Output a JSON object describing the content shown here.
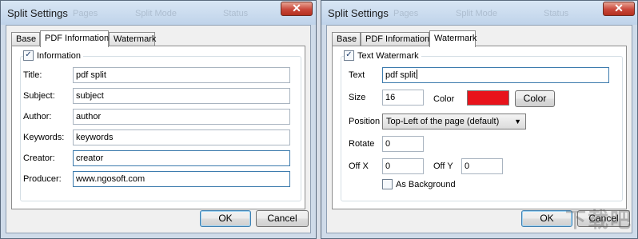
{
  "left": {
    "title": "Split Settings",
    "ghost_items": [
      "Pages",
      "Split Mode",
      "Status"
    ],
    "tabs": [
      "Base",
      "PDF Information",
      "Watermark"
    ],
    "information_label": "Information",
    "fields": [
      {
        "label": "Title:",
        "value": "pdf split"
      },
      {
        "label": "Subject:",
        "value": "subject"
      },
      {
        "label": "Author:",
        "value": "author"
      },
      {
        "label": "Keywords:",
        "value": "keywords"
      },
      {
        "label": "Creator:",
        "value": "creator"
      },
      {
        "label": "Producer:",
        "value": "www.ngosoft.com"
      }
    ],
    "ok_label": "OK",
    "cancel_label": "Cancel"
  },
  "right": {
    "title": "Split Settings",
    "ghost_items": [
      "Pages",
      "Split Mode",
      "Status"
    ],
    "tabs": [
      "Base",
      "PDF Information",
      "Watermark"
    ],
    "text_watermark_label": "Text Watermark",
    "text_label": "Text",
    "text_value": "pdf split",
    "size_label": "Size",
    "size_value": "16",
    "color_label": "Color",
    "color_swatch": "#e8131b",
    "color_button": "Color",
    "position_label": "Position",
    "position_value": "Top-Left of the page (default)",
    "rotate_label": "Rotate",
    "rotate_value": "0",
    "offx_label": "Off X",
    "offx_value": "0",
    "offy_label": "Off Y",
    "offy_value": "0",
    "as_background_label": "As Background",
    "ok_label": "OK",
    "cancel_label": "Cancel"
  },
  "watermark_text": "下载吧",
  "close_glyph": "✕",
  "check_glyph": "✓",
  "dropdown_glyph": "▼"
}
